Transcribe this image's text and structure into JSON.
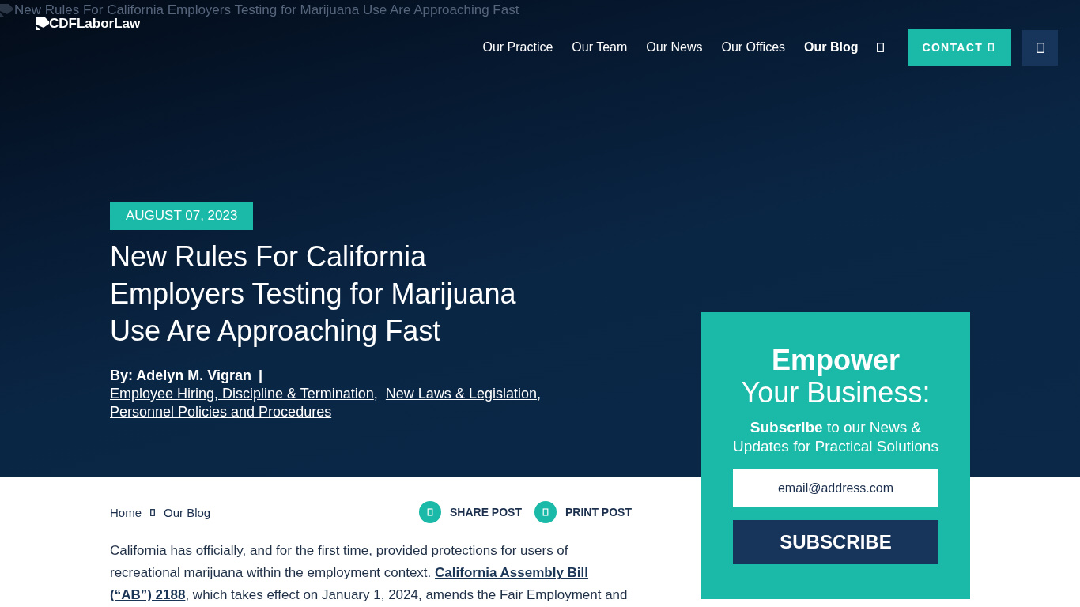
{
  "hero_image": {
    "alt_text": "New Rules For California Employers Testing for Marijuana Use Are Approaching Fast"
  },
  "header": {
    "logo": {
      "alt_text": "CDFLaborLaw"
    },
    "nav": [
      {
        "label": "Our Practice",
        "selected": false
      },
      {
        "label": "Our Team",
        "selected": false
      },
      {
        "label": "Our News",
        "selected": false
      },
      {
        "label": "Our Offices",
        "selected": false
      },
      {
        "label": "Our Blog",
        "selected": true
      }
    ],
    "contact_button": {
      "label": "CONTACT"
    }
  },
  "article": {
    "date": "AUGUST 07, 2023",
    "title": "New Rules For California Employers Testing for Marijuana Use Are Approaching Fast",
    "author": {
      "name": "By: Adelyn M. Vigran",
      "separator": "|"
    },
    "categories": [
      {
        "label": "Employee Hiring, Discipline & Termination",
        "separator": ","
      },
      {
        "label": "New Laws & Legislation",
        "separator": ","
      },
      {
        "label": "Personnel Policies and Procedures"
      }
    ]
  },
  "toolbar": {
    "breadcrumb": [
      {
        "label": "Home",
        "kind": "link"
      },
      {
        "label": "Our Blog",
        "kind": "current"
      }
    ],
    "actions": [
      {
        "label": "SHARE POST"
      },
      {
        "label": "PRINT POST"
      }
    ]
  },
  "body": {
    "segments": [
      {
        "kind": "text",
        "text": "California has officially, and for the first time, provided protections for users of recreational marijuana within the employment context."
      },
      {
        "kind": "link",
        "text": "California Assembly Bill"
      },
      {
        "kind": "link",
        "text": "(“AB”) 2188"
      },
      {
        "kind": "text",
        "text": ", which takes effect on January 1, 2024, amends the Fair Employment and"
      }
    ]
  },
  "subscribe": {
    "heading": "Empower",
    "subheading": "Your Business:",
    "text": "**Subscribe** to our News & Updates for Practical Solutions",
    "email_field": {
      "placeholder": "email@address.com"
    },
    "button": "SUBSCRIBE"
  }
}
